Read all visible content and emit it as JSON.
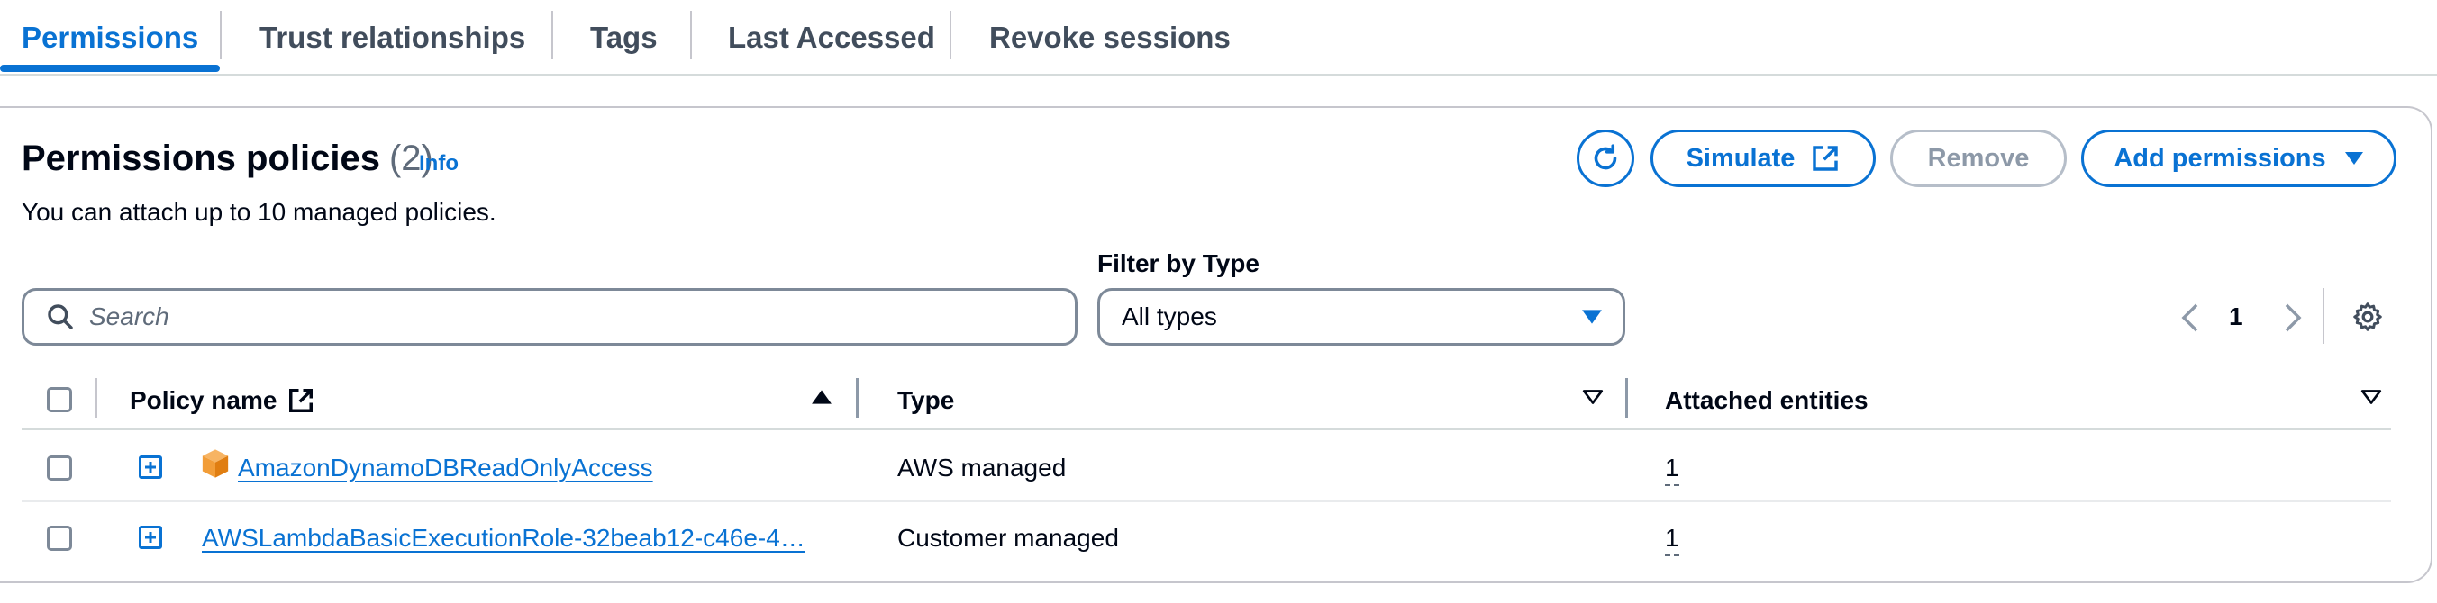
{
  "tabs": [
    {
      "label": "Permissions",
      "active": true
    },
    {
      "label": "Trust relationships"
    },
    {
      "label": "Tags"
    },
    {
      "label": "Last Accessed"
    },
    {
      "label": "Revoke sessions"
    }
  ],
  "header": {
    "title": "Permissions policies",
    "count": "(2)",
    "info": "Info",
    "description": "You can attach up to 10 managed policies."
  },
  "actions": {
    "simulate": "Simulate",
    "remove": "Remove",
    "add_permissions": "Add permissions"
  },
  "filters": {
    "search_placeholder": "Search",
    "filter_label": "Filter by Type",
    "type_selected": "All types"
  },
  "pagination": {
    "current_page": "1"
  },
  "table": {
    "columns": [
      "Policy name",
      "Type",
      "Attached entities"
    ],
    "rows": [
      {
        "policy_name": "AmazonDynamoDBReadOnlyAccess",
        "type": "AWS managed",
        "attached": "1",
        "icon": "aws-managed-cube-icon"
      },
      {
        "policy_name": "AWSLambdaBasicExecutionRole-32beab12-c46e-4…",
        "type": "Customer managed",
        "attached": "1"
      }
    ]
  },
  "colors": {
    "accent": "#0972d3",
    "aws_orange": "#f29d38"
  }
}
